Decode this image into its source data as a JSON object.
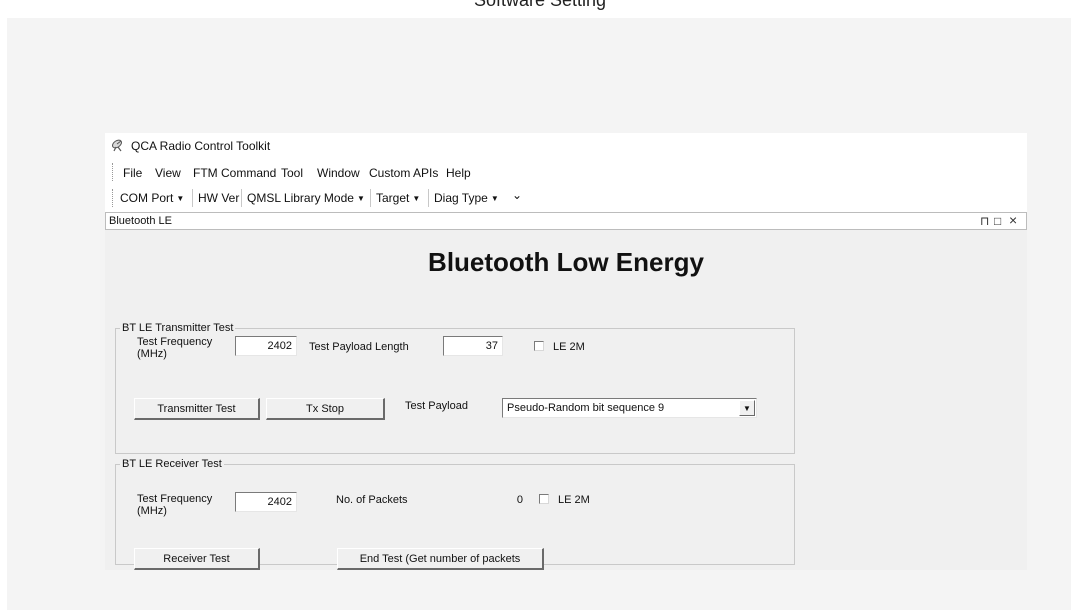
{
  "page_heading": "Software Setting",
  "window": {
    "title": "QCA Radio Control Toolkit",
    "icon": "satellite-dish-icon"
  },
  "menu": {
    "items": [
      "File",
      "View",
      "FTM Command",
      "Tool",
      "Window",
      "Custom APIs",
      "Help"
    ]
  },
  "toolbar": {
    "items": [
      {
        "label": "COM Port",
        "dropdown": true
      },
      {
        "label": "HW Ver",
        "dropdown": false
      },
      {
        "label": "QMSL Library Mode",
        "dropdown": true
      },
      {
        "label": "Target",
        "dropdown": true
      },
      {
        "label": "Diag Type",
        "dropdown": true
      }
    ],
    "overflow": "⌄"
  },
  "panel": {
    "title": "Bluetooth LE",
    "controls": {
      "pin": "⊓",
      "restore": "□",
      "close": "×"
    }
  },
  "main_title": "Bluetooth Low Energy",
  "tx_group": {
    "legend": "BT LE Transmitter Test",
    "freq_label_line1": "Test Frequency",
    "freq_label_line2": "(MHz)",
    "freq_value": "2402",
    "payload_length_label": "Test Payload Length",
    "payload_length_value": "37",
    "le2m_label": "LE 2M",
    "le2m_checked": false,
    "transmitter_button": "Transmitter Test",
    "tx_stop_button": "Tx Stop",
    "payload_label": "Test Payload",
    "payload_selected": "Pseudo-Random bit sequence 9"
  },
  "rx_group": {
    "legend": "BT LE Receiver Test",
    "freq_label_line1": "Test Frequency",
    "freq_label_line2": "(MHz)",
    "freq_value": "2402",
    "packets_label": "No. of Packets",
    "packets_value": "0",
    "le2m_label": "LE 2M",
    "le2m_checked": false,
    "receiver_button": "Receiver Test",
    "end_test_button": "End Test (Get number of packets"
  }
}
